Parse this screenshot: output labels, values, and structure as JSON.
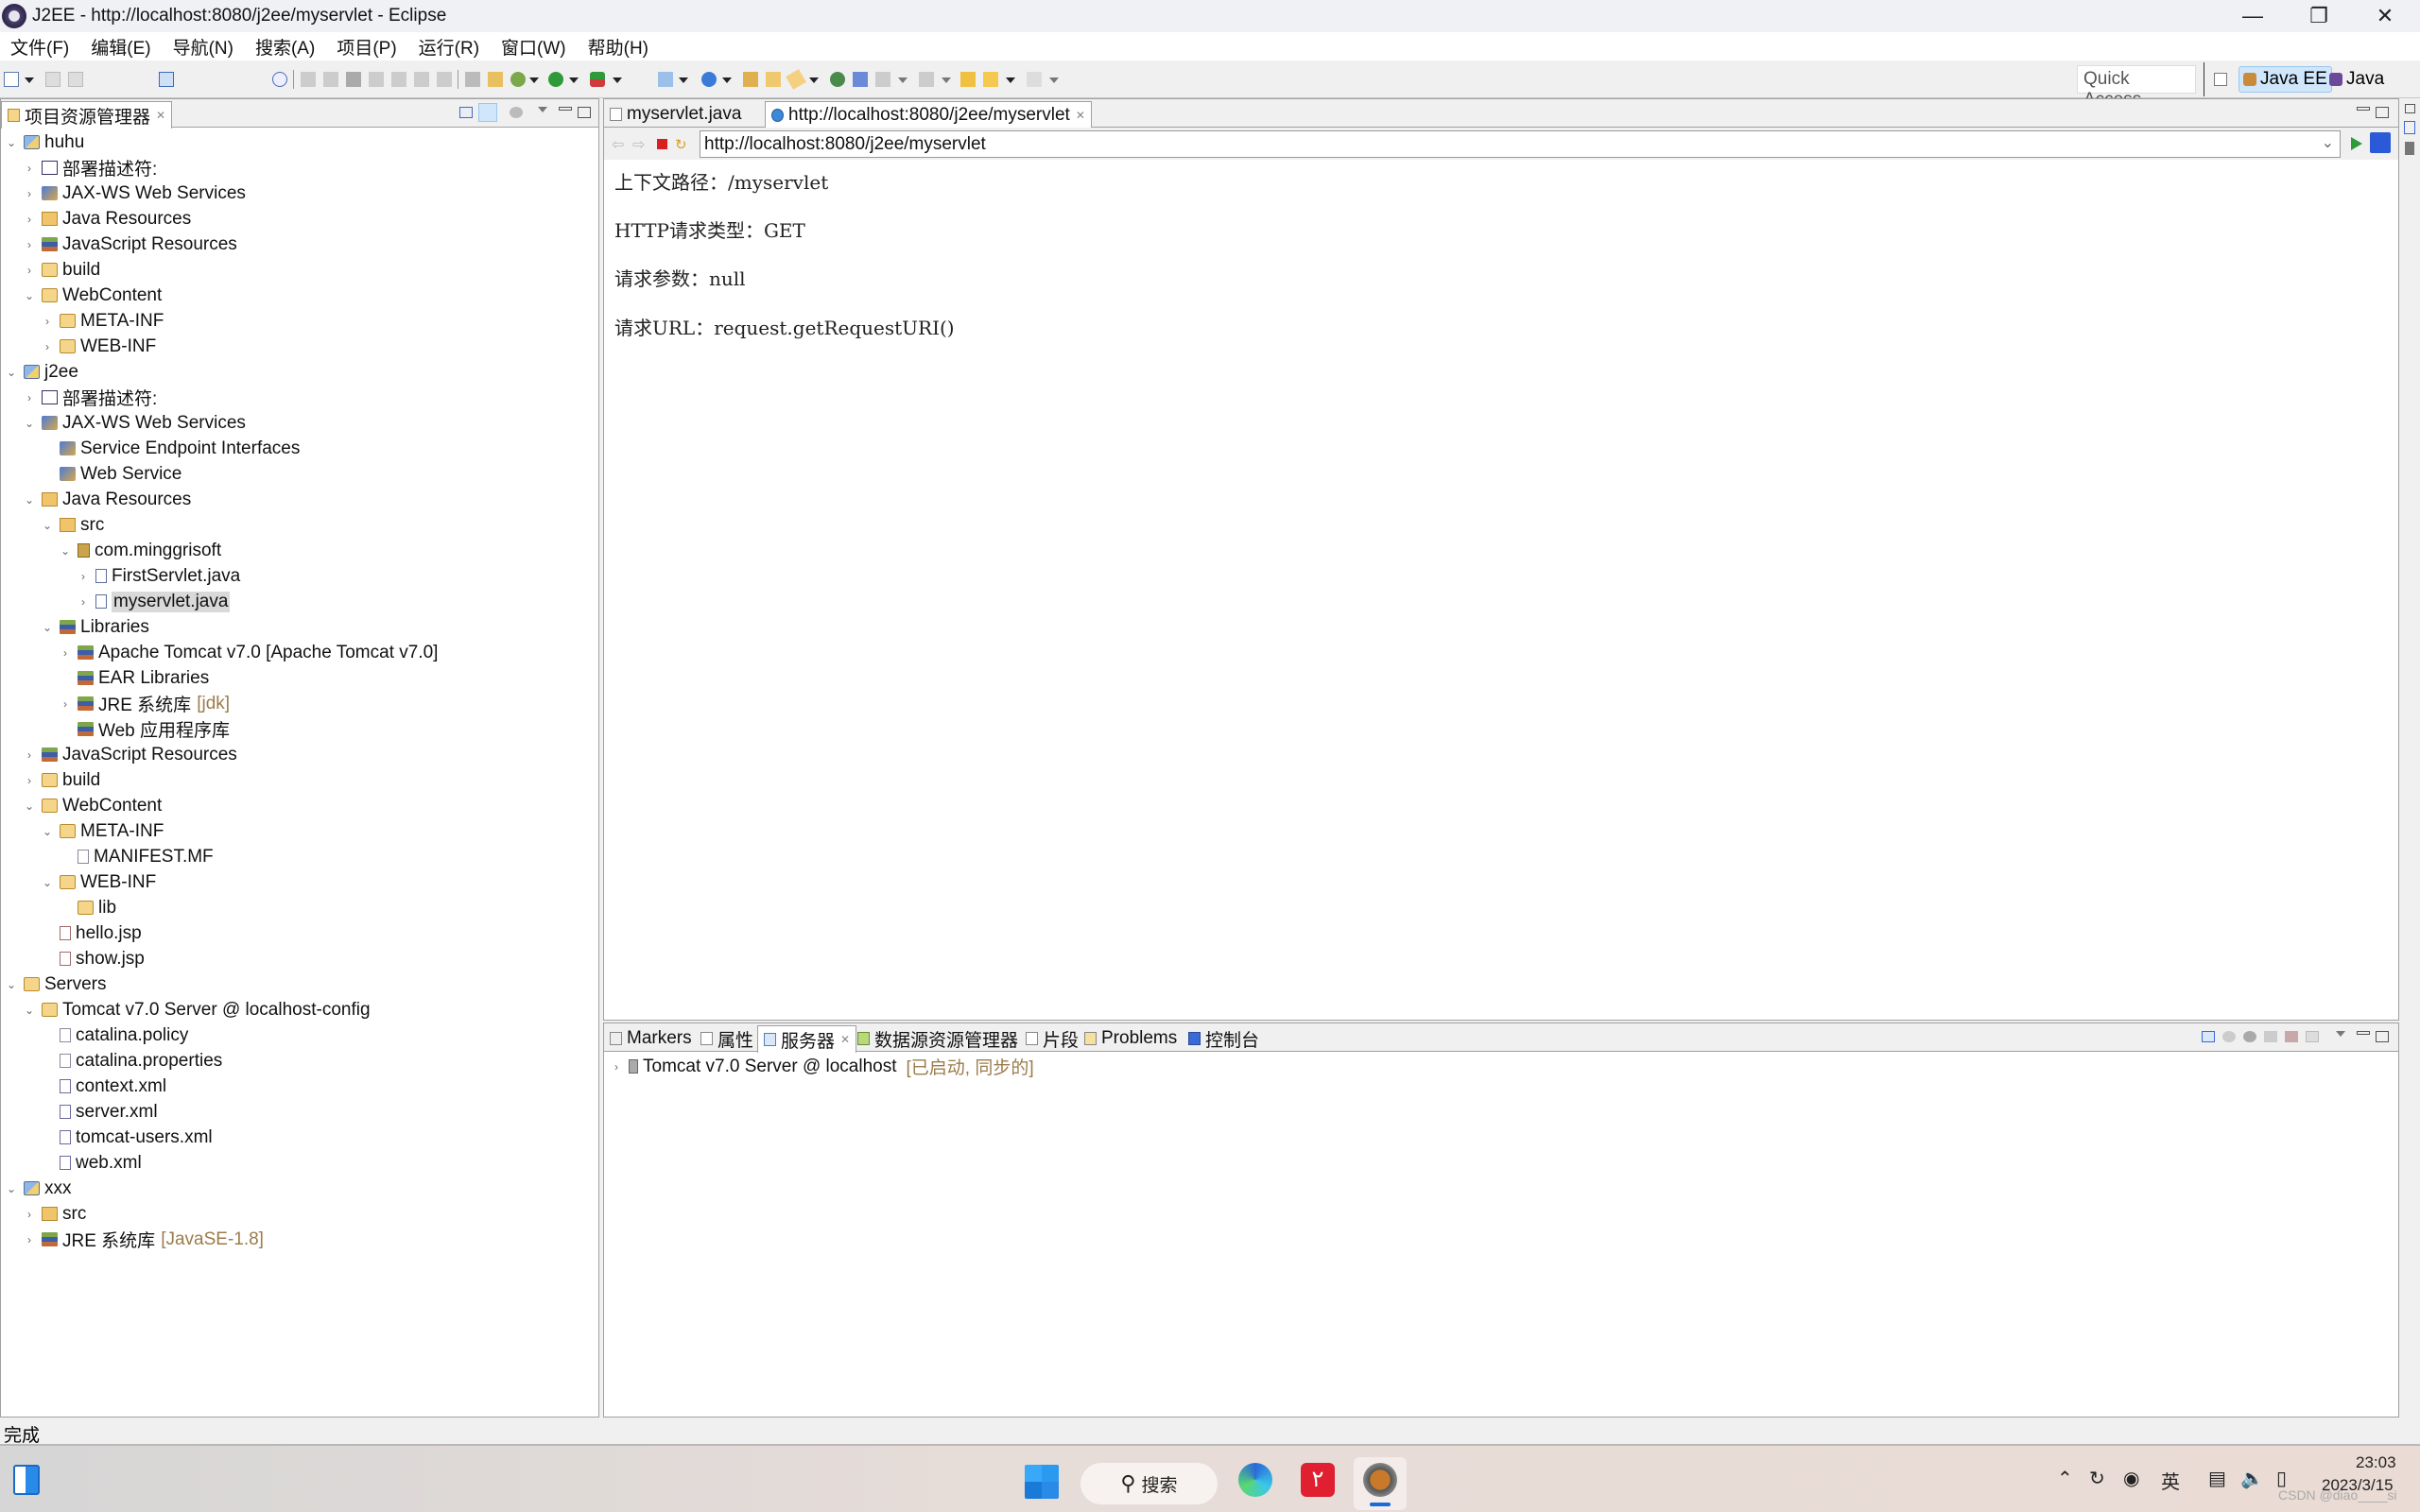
{
  "window": {
    "title": "J2EE - http://localhost:8080/j2ee/myservlet - Eclipse",
    "controls": [
      "minimize",
      "restore",
      "close"
    ]
  },
  "menu": [
    "文件(F)",
    "编辑(E)",
    "导航(N)",
    "搜索(A)",
    "项目(P)",
    "运行(R)",
    "窗口(W)",
    "帮助(H)"
  ],
  "toolbar": {
    "quick_access": "Quick Access",
    "perspectives": [
      {
        "label": "Java EE",
        "active": true
      },
      {
        "label": "Java",
        "active": false
      }
    ]
  },
  "explorer": {
    "tab_label": "项目资源管理器",
    "rows": [
      {
        "label": "huhu",
        "level": 0,
        "twisty": "open",
        "icon": "project"
      },
      {
        "label": "部署描述符:",
        "level": 1,
        "twisty": "closed",
        "icon": "desc"
      },
      {
        "label": "JAX-WS Web Services",
        "level": 1,
        "twisty": "closed",
        "icon": "ws"
      },
      {
        "label": "Java Resources",
        "level": 1,
        "twisty": "closed",
        "icon": "src"
      },
      {
        "label": "JavaScript Resources",
        "level": 1,
        "twisty": "closed",
        "icon": "lib"
      },
      {
        "label": "build",
        "level": 1,
        "twisty": "closed",
        "icon": "folder"
      },
      {
        "label": "WebContent",
        "level": 1,
        "twisty": "open",
        "icon": "folder"
      },
      {
        "label": "META-INF",
        "level": 2,
        "twisty": "closed",
        "icon": "folder"
      },
      {
        "label": "WEB-INF",
        "level": 2,
        "twisty": "closed",
        "icon": "folder"
      },
      {
        "label": "j2ee",
        "level": 0,
        "twisty": "open",
        "icon": "project"
      },
      {
        "label": "部署描述符:",
        "level": 1,
        "twisty": "closed",
        "icon": "desc"
      },
      {
        "label": "JAX-WS Web Services",
        "level": 1,
        "twisty": "open",
        "icon": "ws"
      },
      {
        "label": "Service Endpoint Interfaces",
        "level": 2,
        "twisty": "none",
        "icon": "ws"
      },
      {
        "label": "Web Service",
        "level": 2,
        "twisty": "none",
        "icon": "ws"
      },
      {
        "label": "Java Resources",
        "level": 1,
        "twisty": "open",
        "icon": "src"
      },
      {
        "label": "src",
        "level": 2,
        "twisty": "open",
        "icon": "src"
      },
      {
        "label": "com.minggrisoft",
        "level": 3,
        "twisty": "open",
        "icon": "pkg"
      },
      {
        "label": "FirstServlet.java",
        "level": 4,
        "twisty": "closed",
        "icon": "java"
      },
      {
        "label": "myservlet.java",
        "level": 4,
        "twisty": "closed",
        "icon": "java",
        "selected": true
      },
      {
        "label": "Libraries",
        "level": 2,
        "twisty": "open",
        "icon": "lib"
      },
      {
        "label": "Apache Tomcat v7.0 [Apache Tomcat v7.0]",
        "level": 3,
        "twisty": "closed",
        "icon": "lib"
      },
      {
        "label": "EAR Libraries",
        "level": 3,
        "twisty": "none",
        "icon": "lib"
      },
      {
        "label": "JRE 系统库",
        "decoration": "[jdk]",
        "level": 3,
        "twisty": "closed",
        "icon": "lib"
      },
      {
        "label": "Web 应用程序库",
        "level": 3,
        "twisty": "none",
        "icon": "lib"
      },
      {
        "label": "JavaScript Resources",
        "level": 1,
        "twisty": "closed",
        "icon": "lib"
      },
      {
        "label": "build",
        "level": 1,
        "twisty": "closed",
        "icon": "folder"
      },
      {
        "label": "WebContent",
        "level": 1,
        "twisty": "open",
        "icon": "folder"
      },
      {
        "label": "META-INF",
        "level": 2,
        "twisty": "open",
        "icon": "folder"
      },
      {
        "label": "MANIFEST.MF",
        "level": 3,
        "twisty": "none",
        "icon": "file"
      },
      {
        "label": "WEB-INF",
        "level": 2,
        "twisty": "open",
        "icon": "folder"
      },
      {
        "label": "lib",
        "level": 3,
        "twisty": "none",
        "icon": "folder"
      },
      {
        "label": "hello.jsp",
        "level": 2,
        "twisty": "none",
        "icon": "jsp"
      },
      {
        "label": "show.jsp",
        "level": 2,
        "twisty": "none",
        "icon": "jsp"
      },
      {
        "label": "Servers",
        "level": 0,
        "twisty": "open",
        "icon": "folder"
      },
      {
        "label": "Tomcat v7.0 Server @ localhost-config",
        "level": 1,
        "twisty": "open",
        "icon": "folder"
      },
      {
        "label": "catalina.policy",
        "level": 2,
        "twisty": "none",
        "icon": "file"
      },
      {
        "label": "catalina.properties",
        "level": 2,
        "twisty": "none",
        "icon": "file"
      },
      {
        "label": "context.xml",
        "level": 2,
        "twisty": "none",
        "icon": "xml"
      },
      {
        "label": "server.xml",
        "level": 2,
        "twisty": "none",
        "icon": "xml"
      },
      {
        "label": "tomcat-users.xml",
        "level": 2,
        "twisty": "none",
        "icon": "xml"
      },
      {
        "label": "web.xml",
        "level": 2,
        "twisty": "none",
        "icon": "xml"
      },
      {
        "label": "xxx",
        "level": 0,
        "twisty": "open",
        "icon": "project"
      },
      {
        "label": "src",
        "level": 1,
        "twisty": "closed",
        "icon": "src"
      },
      {
        "label": "JRE 系统库",
        "decoration": "[JavaSE-1.8]",
        "level": 1,
        "twisty": "closed",
        "icon": "lib"
      }
    ]
  },
  "editor": {
    "tabs": [
      {
        "label": "myservlet.java",
        "active": false
      },
      {
        "label": "http://localhost:8080/j2ee/myservlet",
        "active": true
      }
    ],
    "url": "http://localhost:8080/j2ee/myservlet",
    "page_lines": [
      "上下文路径：/myservlet",
      "HTTP请求类型：GET",
      "请求参数：null",
      "请求URL：request.getRequestURI()"
    ]
  },
  "bottom_panel": {
    "tabs": [
      {
        "label": "Markers",
        "active": false
      },
      {
        "label": "属性",
        "active": false
      },
      {
        "label": "服务器",
        "active": true
      },
      {
        "label": "数据源资源管理器",
        "active": false
      },
      {
        "label": "片段",
        "active": false
      },
      {
        "label": "Problems",
        "active": false
      },
      {
        "label": "控制台",
        "active": false
      }
    ],
    "server": {
      "label": "Tomcat v7.0 Server @ localhost",
      "state": "[已启动, 同步的]"
    }
  },
  "status_bar": {
    "text": "完成"
  },
  "taskbar": {
    "search_label": "搜索",
    "ime": "英",
    "time": "23:03",
    "date": "2023/3/15",
    "watermark": "CSDN @diao____si"
  }
}
